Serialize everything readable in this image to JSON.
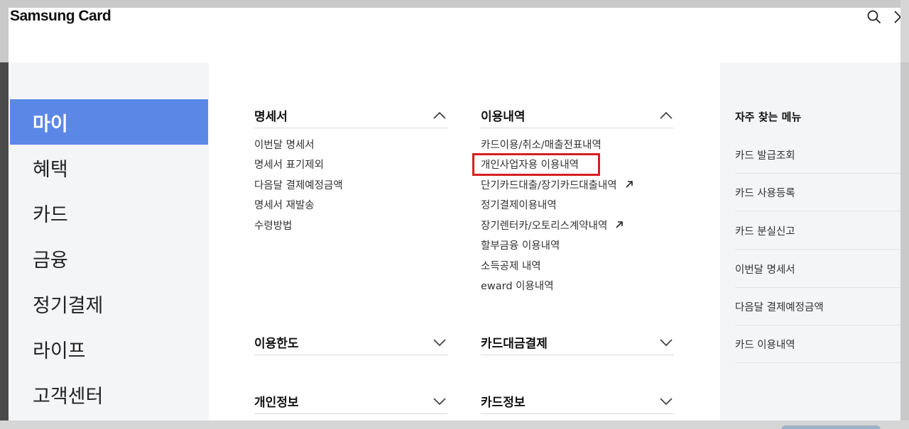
{
  "header": {
    "brand": "Samsung Card",
    "search_icon": "search-icon",
    "close_icon": "close-icon"
  },
  "leftnav": {
    "items": [
      {
        "label": "마이",
        "active": true
      },
      {
        "label": "혜택",
        "active": false
      },
      {
        "label": "카드",
        "active": false
      },
      {
        "label": "금융",
        "active": false
      },
      {
        "label": "정기결제",
        "active": false
      },
      {
        "label": "라이프",
        "active": false
      },
      {
        "label": "고객센터",
        "active": false
      }
    ]
  },
  "sections": {
    "statement": {
      "title": "명세서",
      "expanded": true,
      "links": [
        "이번달 명세서",
        "명세서 표기제외",
        "다음달 결제예정금액",
        "명세서 재발송",
        "수령방법"
      ]
    },
    "usage": {
      "title": "이용내역",
      "expanded": true,
      "links": [
        {
          "label": "카드이용/취소/매출전표내역",
          "external": false
        },
        {
          "label": "개인사업자용 이용내역",
          "external": false,
          "highlighted": true
        },
        {
          "label": "단기카드대출/장기카드대출내역",
          "external": true
        },
        {
          "label": "정기결제이용내역",
          "external": false
        },
        {
          "label": "장기렌터카/오토리스계약내역",
          "external": true
        },
        {
          "label": "할부금융 이용내역",
          "external": false
        },
        {
          "label": "소득공제 내역",
          "external": false
        },
        {
          "label": "eward 이용내역",
          "external": false
        }
      ]
    },
    "limit": {
      "title": "이용한도",
      "expanded": false
    },
    "payment": {
      "title": "카드대금결제",
      "expanded": false
    },
    "personal": {
      "title": "개인정보",
      "expanded": false
    },
    "cardinfo": {
      "title": "카드정보",
      "expanded": false
    }
  },
  "frequent": {
    "title": "자주 찾는 메뉴",
    "items": [
      "카드 발급조회",
      "카드 사용등록",
      "카드 분실신고",
      "이번달 명세서",
      "다음달 결제예정금액",
      "카드 이용내역"
    ]
  },
  "colors": {
    "accent": "#5b87e6",
    "highlight_box": "#d42020",
    "panel_bg": "#f4f5f7"
  }
}
